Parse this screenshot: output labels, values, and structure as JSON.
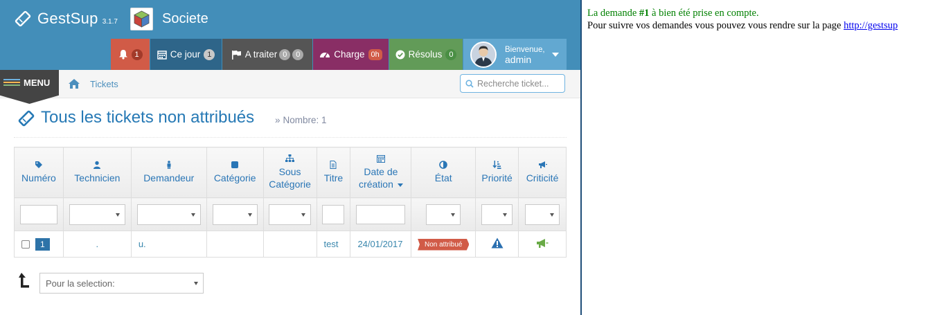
{
  "brand": {
    "name": "GestSup",
    "version": "3.1.7"
  },
  "company": {
    "name": "Societe"
  },
  "navbar": {
    "notifications": {
      "badge": "1"
    },
    "today": {
      "label": "Ce jour",
      "badge": "1"
    },
    "todo": {
      "label": "A traiter",
      "badge1": "0",
      "badge2": "0"
    },
    "load": {
      "label": "Charge",
      "badge": "0h"
    },
    "solved": {
      "label": "Résolus",
      "badge": "0"
    },
    "user": {
      "greeting": "Bienvenue,",
      "name": "admin"
    }
  },
  "menu": {
    "label": "MENU"
  },
  "breadcrumb": {
    "item": "Tickets"
  },
  "search": {
    "placeholder": "Recherche ticket..."
  },
  "page": {
    "title": "Tous les tickets non attribués",
    "subtitle": "Nombre: 1"
  },
  "table": {
    "headers": {
      "numero": "Numéro",
      "technicien": "Technicien",
      "demandeur": "Demandeur",
      "categorie": "Catégorie",
      "sous1": "Sous",
      "sous2": "Catégorie",
      "titre": "Titre",
      "date1": "Date de",
      "date2": "création",
      "etat": "État",
      "priorite": "Priorité",
      "criticite": "Criticité"
    },
    "rows": [
      {
        "numero": "1",
        "technicien": ".",
        "demandeur": "u.",
        "categorie": "",
        "sous_categorie": "",
        "titre": "test",
        "date": "24/01/2017",
        "etat": "Non attribué"
      }
    ]
  },
  "bulk_action": {
    "placeholder": "Pour la selection:"
  },
  "notice": {
    "line1_before": "La demande ",
    "line1_id": "#1",
    "line1_after": " à bien été prise en compte.",
    "line2": "Pour suivre vos demandes vous pouvez vous rendre sur la page ",
    "link": "http://gestsup"
  },
  "colors": {
    "navbar": "#438eb9",
    "notif": "#d15b47",
    "today": "#2e6589",
    "todo": "#555555",
    "load": "#892e65",
    "solved": "#629b58",
    "user": "#62a8d1",
    "title": "#2679b5",
    "status_unassigned": "#d15b47"
  }
}
